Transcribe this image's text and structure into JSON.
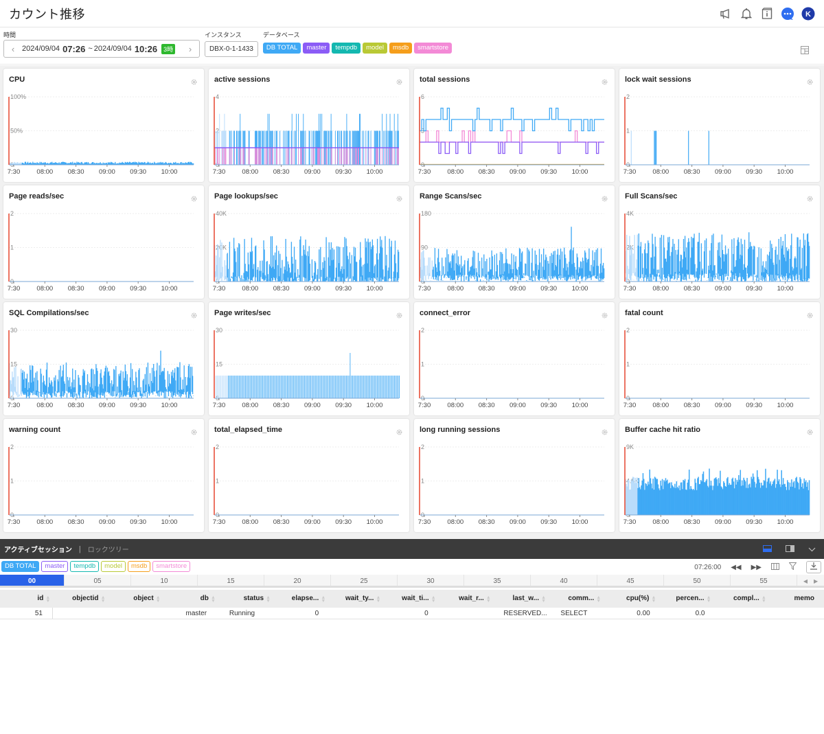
{
  "header": {
    "title": "カウント推移",
    "icons": [
      "megaphone-icon",
      "bell-icon",
      "info-book-icon",
      "chat-icon",
      "user-avatar"
    ],
    "avatar_letter": "K"
  },
  "filters": {
    "time_label": "時間",
    "start_date": "2024/09/04",
    "start_time": "07:26",
    "separator": "~",
    "end_date": "2024/09/04",
    "end_time": "10:26",
    "range_badge": "3時",
    "instance_label": "インスタンス",
    "instance_value": "DBX-0-1-1433",
    "database_label": "データベース",
    "databases": [
      {
        "label": "DB TOTAL",
        "color": "#3fa9f5"
      },
      {
        "label": "master",
        "color": "#8b5cf6"
      },
      {
        "label": "tempdb",
        "color": "#14b8b0"
      },
      {
        "label": "model",
        "color": "#b9c935"
      },
      {
        "label": "msdb",
        "color": "#f59e1b"
      },
      {
        "label": "smartstore",
        "color": "#f38ad6"
      }
    ]
  },
  "colors": {
    "series_total": "#3fa9f5",
    "series_total_light": "#b8dcfb",
    "series_master": "#8b5cf6",
    "series_smartstore": "#f38ad6",
    "current_marker": "#e8503a"
  },
  "chart_data": [
    {
      "id": "cpu",
      "type": "area",
      "title": "CPU",
      "x_ticks": [
        "7:30",
        "08:00",
        "08:30",
        "09:00",
        "09:30",
        "10:00"
      ],
      "y_ticks": [
        "100%",
        "50%",
        "0"
      ],
      "ylim": [
        0,
        100
      ],
      "pattern": "noise",
      "series": [
        {
          "name": "DB TOTAL",
          "base": 3,
          "amp": 3
        }
      ]
    },
    {
      "id": "active",
      "type": "bar",
      "title": "active sessions",
      "x_ticks": [
        "7:30",
        "08:00",
        "08:30",
        "09:00",
        "09:30",
        "10:00"
      ],
      "y_ticks": [
        "4",
        "2",
        "0"
      ],
      "ylim": [
        0,
        4
      ],
      "pattern": "sessions",
      "series": [
        {
          "name": "DB TOTAL",
          "typical": 2,
          "peak": 3
        },
        {
          "name": "master",
          "typical": 1
        },
        {
          "name": "smartstore",
          "typical": 1
        }
      ]
    },
    {
      "id": "total",
      "type": "line",
      "title": "total sessions",
      "x_ticks": [
        "7:30",
        "08:00",
        "08:30",
        "09:00",
        "09:30",
        "10:00"
      ],
      "y_ticks": [
        "6",
        "3",
        "0"
      ],
      "ylim": [
        0,
        6
      ],
      "pattern": "steps",
      "series": [
        {
          "name": "DB TOTAL",
          "typical": 4,
          "high": 5,
          "low": 3
        },
        {
          "name": "smartstore",
          "typical": 2,
          "high": 3
        },
        {
          "name": "master",
          "typical": 2,
          "low": 1
        }
      ]
    },
    {
      "id": "lockwait",
      "type": "bar",
      "title": "lock wait sessions",
      "x_ticks": [
        "7:30",
        "08:00",
        "08:30",
        "09:00",
        "09:30",
        "10:00"
      ],
      "y_ticks": [
        "2",
        "1",
        "0"
      ],
      "ylim": [
        0,
        2
      ],
      "pattern": "spikes",
      "series": [
        {
          "name": "DB TOTAL",
          "spikes_at": [
            "07:31",
            "07:45",
            "07:46",
            "07:47",
            "08:21",
            "08:41"
          ],
          "value": 1
        }
      ]
    },
    {
      "id": "pagereads",
      "type": "line",
      "title": "Page reads/sec",
      "x_ticks": [
        "7:30",
        "08:00",
        "08:30",
        "09:00",
        "09:30",
        "10:00"
      ],
      "y_ticks": [
        "2",
        "1",
        "0"
      ],
      "ylim": [
        0,
        2
      ],
      "pattern": "flat",
      "series": [
        {
          "name": "DB TOTAL",
          "value": 0
        }
      ]
    },
    {
      "id": "pagelookups",
      "type": "area",
      "title": "Page lookups/sec",
      "x_ticks": [
        "7:30",
        "08:00",
        "08:30",
        "09:00",
        "09:30",
        "10:00"
      ],
      "y_ticks": [
        "40K",
        "20K",
        "0"
      ],
      "ylim": [
        0,
        40000
      ],
      "pattern": "dense",
      "series": [
        {
          "name": "DB TOTAL",
          "base": 12000,
          "amp": 15000
        }
      ]
    },
    {
      "id": "rangescans",
      "type": "area",
      "title": "Range Scans/sec",
      "x_ticks": [
        "7:30",
        "08:00",
        "08:30",
        "09:00",
        "09:30",
        "10:00"
      ],
      "y_ticks": [
        "180",
        "90",
        "0"
      ],
      "ylim": [
        0,
        180
      ],
      "pattern": "dense",
      "series": [
        {
          "name": "DB TOTAL",
          "base": 45,
          "amp": 45,
          "max": 145
        }
      ]
    },
    {
      "id": "fullscans",
      "type": "area",
      "title": "Full Scans/sec",
      "x_ticks": [
        "7:30",
        "08:00",
        "08:30",
        "09:00",
        "09:30",
        "10:00"
      ],
      "y_ticks": [
        "4K",
        "2K",
        "0"
      ],
      "ylim": [
        0,
        4000
      ],
      "pattern": "dense",
      "series": [
        {
          "name": "DB TOTAL",
          "base": 1400,
          "amp": 1500
        }
      ]
    },
    {
      "id": "sqlcomp",
      "type": "area",
      "title": "SQL Compilations/sec",
      "x_ticks": [
        "7:30",
        "08:00",
        "08:30",
        "09:00",
        "09:30",
        "10:00"
      ],
      "y_ticks": [
        "30",
        "15",
        "0"
      ],
      "ylim": [
        0,
        30
      ],
      "pattern": "dense",
      "series": [
        {
          "name": "DB TOTAL",
          "base": 8,
          "amp": 8,
          "max": 21
        }
      ]
    },
    {
      "id": "pagewrites",
      "type": "bar",
      "title": "Page writes/sec",
      "x_ticks": [
        "7:30",
        "08:00",
        "08:30",
        "09:00",
        "09:30",
        "10:00"
      ],
      "y_ticks": [
        "30",
        "15",
        "0"
      ],
      "ylim": [
        0,
        30
      ],
      "pattern": "comb",
      "series": [
        {
          "name": "DB TOTAL",
          "value": 10,
          "spike": 20
        }
      ]
    },
    {
      "id": "connerr",
      "type": "line",
      "title": "connect_error",
      "x_ticks": [
        "7:30",
        "08:00",
        "08:30",
        "09:00",
        "09:30",
        "10:00"
      ],
      "y_ticks": [
        "2",
        "1",
        "0"
      ],
      "ylim": [
        0,
        2
      ],
      "pattern": "flat",
      "series": [
        {
          "name": "DB TOTAL",
          "value": 0
        }
      ]
    },
    {
      "id": "fatal",
      "type": "line",
      "title": "fatal count",
      "x_ticks": [
        "7:30",
        "08:00",
        "08:30",
        "09:00",
        "09:30",
        "10:00"
      ],
      "y_ticks": [
        "2",
        "1",
        "0"
      ],
      "ylim": [
        0,
        2
      ],
      "pattern": "flat",
      "series": [
        {
          "name": "DB TOTAL",
          "value": 0
        }
      ]
    },
    {
      "id": "warning",
      "type": "line",
      "title": "warning count",
      "x_ticks": [
        "7:30",
        "08:00",
        "08:30",
        "09:00",
        "09:30",
        "10:00"
      ],
      "y_ticks": [
        "2",
        "1",
        "0"
      ],
      "ylim": [
        0,
        2
      ],
      "pattern": "flat",
      "series": [
        {
          "name": "DB TOTAL",
          "value": 0
        }
      ]
    },
    {
      "id": "elapsed",
      "type": "line",
      "title": "total_elapsed_time",
      "x_ticks": [
        "7:30",
        "08:00",
        "08:30",
        "09:00",
        "09:30",
        "10:00"
      ],
      "y_ticks": [
        "2",
        "1",
        "0"
      ],
      "ylim": [
        0,
        2
      ],
      "pattern": "flat",
      "series": [
        {
          "name": "DB TOTAL",
          "value": 0
        }
      ]
    },
    {
      "id": "longrun",
      "type": "line",
      "title": "long running sessions",
      "x_ticks": [
        "7:30",
        "08:00",
        "08:30",
        "09:00",
        "09:30",
        "10:00"
      ],
      "y_ticks": [
        "2",
        "1",
        "0"
      ],
      "ylim": [
        0,
        2
      ],
      "pattern": "flat",
      "series": [
        {
          "name": "DB TOTAL",
          "value": 0
        }
      ]
    },
    {
      "id": "buffer",
      "type": "bar",
      "title": "Buffer cache hit ratio",
      "x_ticks": [
        "7:30",
        "08:00",
        "08:30",
        "09:00",
        "09:30",
        "10:00"
      ],
      "y_ticks": [
        "9K",
        "4.5K",
        "0"
      ],
      "ylim": [
        0,
        9000
      ],
      "pattern": "buffer",
      "series": [
        {
          "name": "DB TOTAL",
          "base": 3800,
          "amp": 1800,
          "max": 6500
        }
      ]
    }
  ],
  "bottom_panel": {
    "tab_active": "アクティブセッション",
    "tab_separator": "|",
    "tab_inactive": "ロックツリー",
    "chips": [
      {
        "label": "DB TOTAL",
        "color": "#3fa9f5",
        "filled": true
      },
      {
        "label": "master",
        "color": "#8b5cf6",
        "filled": false
      },
      {
        "label": "tempdb",
        "color": "#14b8b0",
        "filled": false
      },
      {
        "label": "model",
        "color": "#b9c935",
        "filled": false
      },
      {
        "label": "msdb",
        "color": "#f59e1b",
        "filled": false
      },
      {
        "label": "smartstore",
        "color": "#f38ad6",
        "filled": false
      }
    ],
    "current_time": "07:26:00",
    "timeline": [
      "00",
      "05",
      "10",
      "15",
      "20",
      "25",
      "30",
      "35",
      "40",
      "45",
      "50",
      "55"
    ],
    "timeline_active": "00",
    "columns": [
      "id",
      "objectid",
      "object",
      "db",
      "status",
      "elapse...",
      "wait_ty...",
      "wait_ti...",
      "wait_r...",
      "last_w...",
      "comm...",
      "cpu(%)",
      "percen...",
      "compl...",
      "memo"
    ],
    "rows": [
      [
        "51",
        "",
        "",
        "master",
        "Running",
        "0",
        "",
        "0",
        "",
        "RESERVED...",
        "SELECT",
        "0.00",
        "0.0",
        "",
        ""
      ]
    ]
  }
}
